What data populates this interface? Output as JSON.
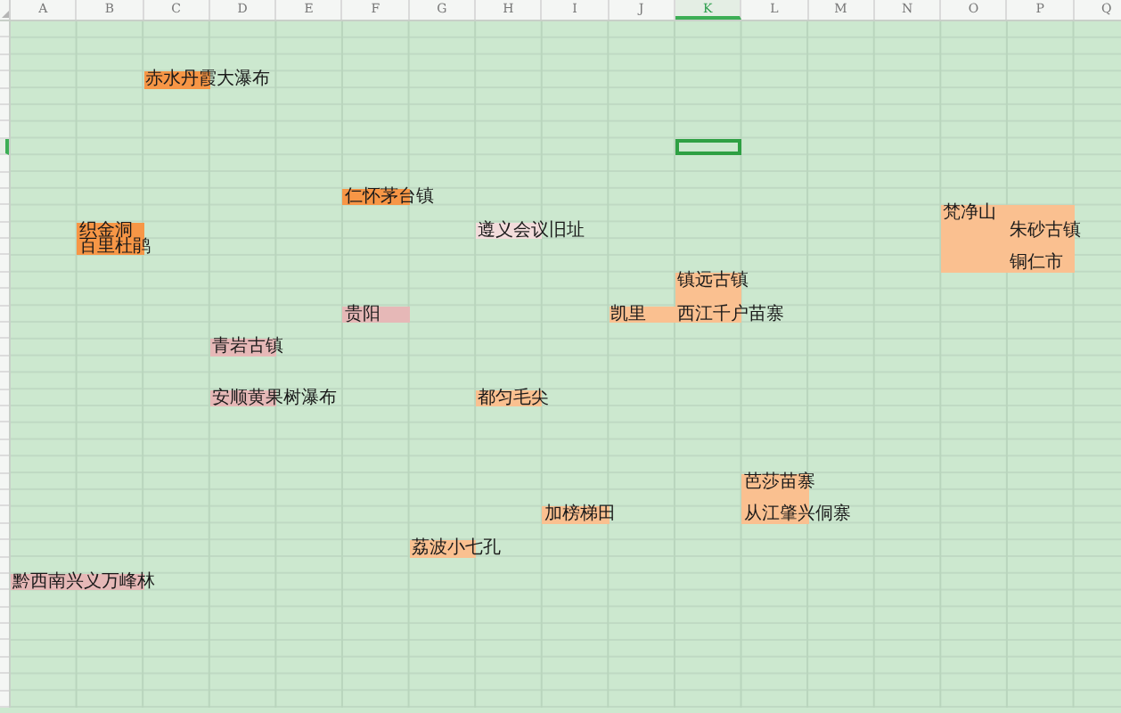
{
  "columns": [
    {
      "label": "A",
      "selected": false
    },
    {
      "label": "B",
      "selected": false
    },
    {
      "label": "C",
      "selected": false
    },
    {
      "label": "D",
      "selected": false
    },
    {
      "label": "E",
      "selected": false
    },
    {
      "label": "F",
      "selected": false
    },
    {
      "label": "G",
      "selected": false
    },
    {
      "label": "H",
      "selected": false
    },
    {
      "label": "I",
      "selected": false
    },
    {
      "label": "J",
      "selected": false
    },
    {
      "label": "K",
      "selected": true
    },
    {
      "label": "L",
      "selected": false
    },
    {
      "label": "M",
      "selected": false
    },
    {
      "label": "N",
      "selected": false
    },
    {
      "label": "O",
      "selected": false
    },
    {
      "label": "P",
      "selected": false
    },
    {
      "label": "Q",
      "selected": false
    }
  ],
  "rows": [
    {
      "selected": false
    },
    {
      "selected": false
    },
    {
      "selected": false
    },
    {
      "selected": false,
      "cells": [
        {},
        {},
        {
          "text": "赤水丹霞大瀑布",
          "color": "#f79646"
        }
      ]
    },
    {
      "selected": false
    },
    {
      "selected": false
    },
    {
      "selected": false
    },
    {
      "selected": true
    },
    {
      "selected": false
    },
    {
      "selected": false
    },
    {
      "selected": false,
      "cells": [
        {},
        {},
        {},
        {},
        {},
        {
          "text": "仁怀茅台镇",
          "color": "#f79646"
        }
      ]
    },
    {
      "selected": false,
      "cells": [
        {},
        {},
        {},
        {},
        {},
        {},
        {},
        {},
        {},
        {},
        {},
        {},
        {},
        {},
        {
          "text": "梵净山",
          "color": "#fac090"
        },
        {
          "color": "#fac090"
        }
      ]
    },
    {
      "selected": false,
      "cells": [
        {},
        {
          "text": "织金洞",
          "color": "#f79646"
        },
        {},
        {},
        {},
        {},
        {},
        {
          "text": "遵义会议旧址",
          "color": "#f2dcdb"
        },
        {},
        {},
        {},
        {},
        {},
        {},
        {
          "color": "#fac090"
        },
        {
          "text": "朱砂古镇",
          "color": "#fac090"
        }
      ]
    },
    {
      "selected": false,
      "cells": [
        {},
        {
          "text": "百里杜鹃",
          "color": "#f79646"
        },
        {},
        {},
        {},
        {},
        {},
        {},
        {},
        {},
        {},
        {},
        {},
        {},
        {
          "color": "#fac090"
        },
        {
          "color": "#fac090"
        }
      ]
    },
    {
      "selected": false,
      "cells": [
        {},
        {},
        {},
        {},
        {},
        {},
        {},
        {},
        {},
        {},
        {},
        {},
        {},
        {},
        {
          "color": "#fac090"
        },
        {
          "text": "铜仁市",
          "color": "#fac090"
        }
      ]
    },
    {
      "selected": false,
      "cells": [
        {},
        {},
        {},
        {},
        {},
        {},
        {},
        {},
        {},
        {},
        {
          "text": "镇远古镇",
          "color": "#fac090"
        }
      ]
    },
    {
      "selected": false,
      "cells": [
        {},
        {},
        {},
        {},
        {},
        {},
        {},
        {},
        {},
        {},
        {
          "color": "#fac090"
        }
      ]
    },
    {
      "selected": false,
      "cells": [
        {},
        {},
        {},
        {},
        {},
        {
          "text": "贵阳",
          "color": "#e6b8b7"
        },
        {},
        {},
        {},
        {
          "text": "凯里",
          "color": "#fac090"
        },
        {
          "text": "西江千户苗寨",
          "color": "#fac090"
        }
      ]
    },
    {
      "selected": false
    },
    {
      "selected": false,
      "cells": [
        {},
        {},
        {},
        {
          "text": "青岩古镇",
          "color": "#e6b8b7"
        }
      ]
    },
    {
      "selected": false
    },
    {
      "selected": false
    },
    {
      "selected": false,
      "cells": [
        {},
        {},
        {},
        {
          "text": "安顺黄果树瀑布",
          "color": "#e6b8b7"
        },
        {},
        {},
        {},
        {
          "text": "都匀毛尖",
          "color": "#fac090"
        }
      ]
    },
    {
      "selected": false
    },
    {
      "selected": false
    },
    {
      "selected": false
    },
    {
      "selected": false
    },
    {
      "selected": false,
      "cells": [
        {},
        {},
        {},
        {},
        {},
        {},
        {},
        {},
        {},
        {},
        {},
        {
          "text": "芭莎苗寨",
          "color": "#fac090"
        }
      ]
    },
    {
      "selected": false,
      "cells": [
        {},
        {},
        {},
        {},
        {},
        {},
        {},
        {},
        {},
        {},
        {},
        {
          "color": "#fac090"
        }
      ]
    },
    {
      "selected": false,
      "cells": [
        {},
        {},
        {},
        {},
        {},
        {},
        {},
        {},
        {
          "text": "加榜梯田",
          "color": "#fac090"
        },
        {},
        {},
        {
          "text": "从江肇兴侗寨",
          "color": "#fac090"
        }
      ]
    },
    {
      "selected": false
    },
    {
      "selected": false,
      "cells": [
        {},
        {},
        {},
        {},
        {},
        {},
        {
          "text": "荔波小七孔",
          "color": "#fac090"
        }
      ]
    },
    {
      "selected": false
    },
    {
      "selected": false,
      "cells": [
        {
          "text": "黔西南兴义万峰林",
          "color": "#e6b8b7"
        },
        {
          "color": "#e6b8b7"
        }
      ]
    },
    {
      "selected": false
    },
    {
      "selected": false
    },
    {
      "selected": false
    },
    {
      "selected": false
    },
    {
      "selected": false
    },
    {
      "selected": false
    },
    {
      "selected": false
    }
  ]
}
